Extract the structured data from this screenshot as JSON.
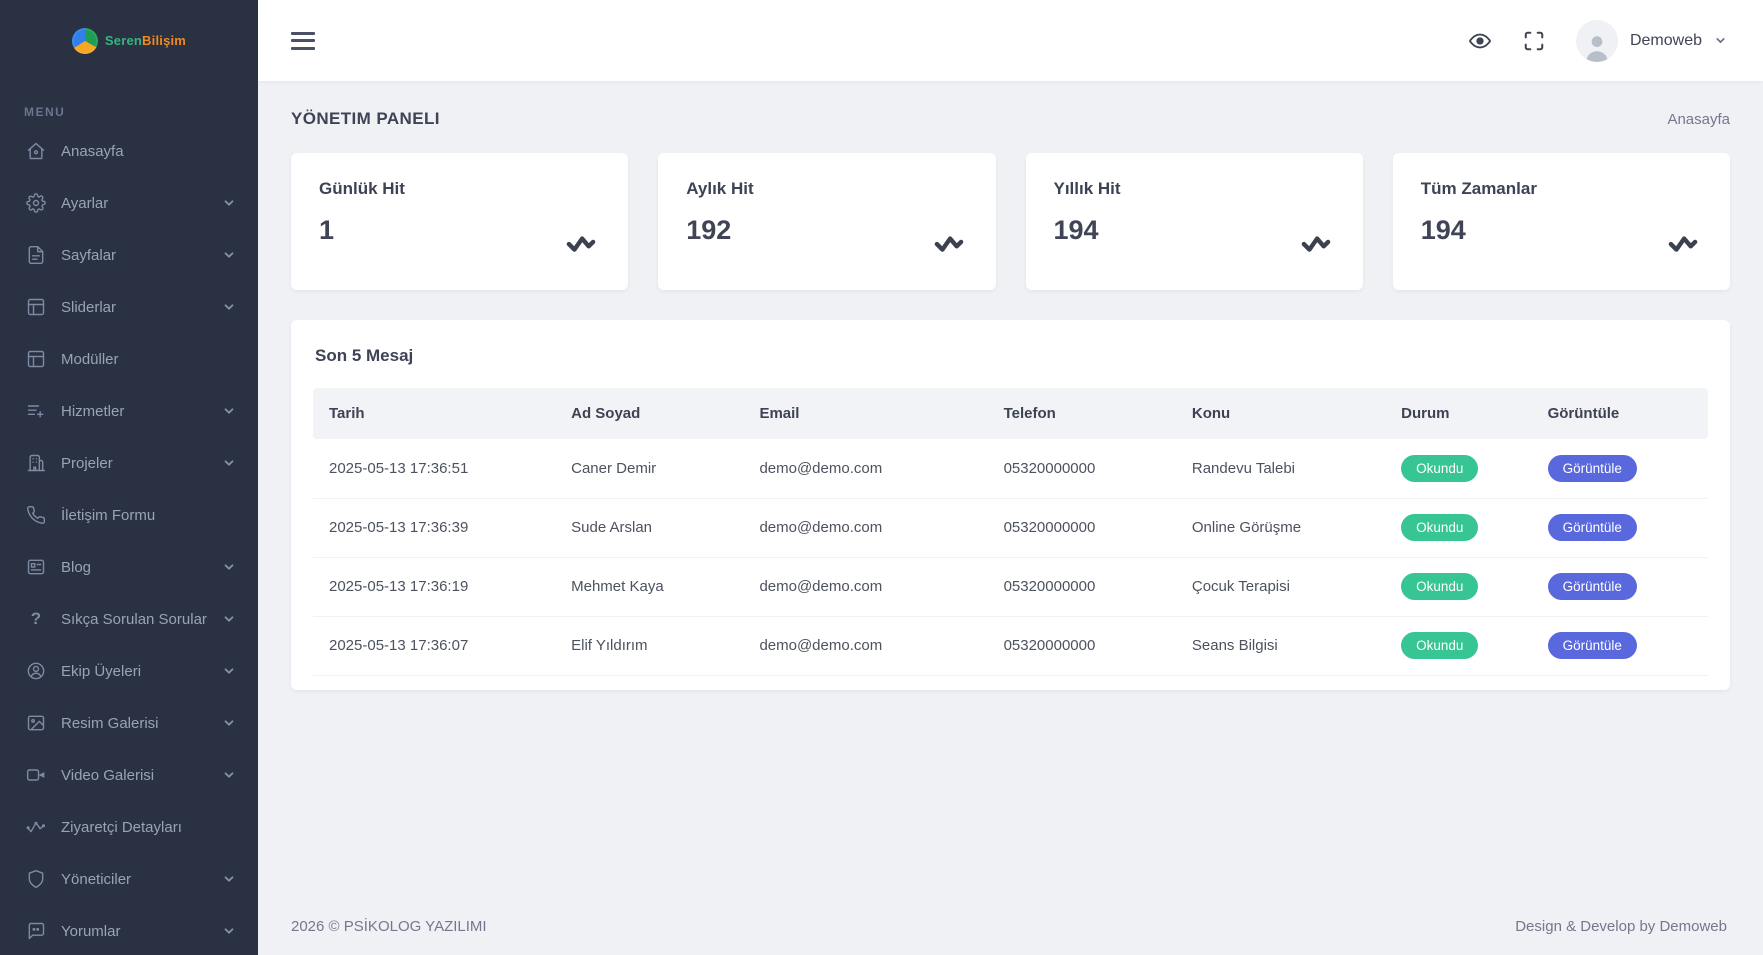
{
  "colors": {
    "sidebar_bg": "#2a3142",
    "status_green": "#37c593",
    "action_indigo": "#5a68dd",
    "brand_green": "#35b57f",
    "brand_orange": "#f08a1d"
  },
  "brand": {
    "name_part1": "Seren",
    "name_part2": "Bilişim"
  },
  "sidebar": {
    "menu_label": "MENU",
    "items": [
      {
        "label": "Anasayfa",
        "icon": "home-icon",
        "chevron": false
      },
      {
        "label": "Ayarlar",
        "icon": "gear-icon",
        "chevron": true
      },
      {
        "label": "Sayfalar",
        "icon": "file-icon",
        "chevron": true
      },
      {
        "label": "Sliderlar",
        "icon": "layout-icon",
        "chevron": true
      },
      {
        "label": "Modüller",
        "icon": "layout-icon",
        "chevron": false
      },
      {
        "label": "Hizmetler",
        "icon": "list-plus-icon",
        "chevron": true
      },
      {
        "label": "Projeler",
        "icon": "building-icon",
        "chevron": true
      },
      {
        "label": "İletişim Formu",
        "icon": "phone-icon",
        "chevron": false
      },
      {
        "label": "Blog",
        "icon": "blog-card-icon",
        "chevron": true
      },
      {
        "label": "Sıkça Sorulan Sorular",
        "icon": "question-icon",
        "chevron": true
      },
      {
        "label": "Ekip Üyeleri",
        "icon": "user-circle-icon",
        "chevron": true
      },
      {
        "label": "Resim Galerisi",
        "icon": "image-icon",
        "chevron": true
      },
      {
        "label": "Video Galerisi",
        "icon": "video-icon",
        "chevron": true
      },
      {
        "label": "Ziyaretçi Detayları",
        "icon": "activity-icon",
        "chevron": false
      },
      {
        "label": "Yöneticiler",
        "icon": "shield-icon",
        "chevron": true
      },
      {
        "label": "Yorumlar",
        "icon": "comment-icon",
        "chevron": true
      }
    ]
  },
  "topbar": {
    "icons": [
      "menu-icon",
      "eye-icon",
      "fullscreen-icon"
    ],
    "user_name": "Demoweb"
  },
  "page": {
    "title": "YÖNETIM PANELI",
    "breadcrumb": "Anasayfa"
  },
  "stats": {
    "cards": [
      {
        "label": "Günlük Hit",
        "value": "1",
        "icon": "activity-icon"
      },
      {
        "label": "Aylık Hit",
        "value": "192",
        "icon": "activity-icon"
      },
      {
        "label": "Yıllık Hit",
        "value": "194",
        "icon": "activity-icon"
      },
      {
        "label": "Tüm Zamanlar",
        "value": "194",
        "icon": "activity-icon"
      }
    ]
  },
  "messages": {
    "title": "Son 5 Mesaj",
    "columns": [
      "Tarih",
      "Ad Soyad",
      "Email",
      "Telefon",
      "Konu",
      "Durum",
      "Görüntüle"
    ],
    "rows": [
      {
        "date": "2025-05-13 17:36:51",
        "name": "Caner Demir",
        "email": "demo@demo.com",
        "phone": "05320000000",
        "subject": "Randevu Talebi",
        "status": "Okundu",
        "action": "Görüntüle"
      },
      {
        "date": "2025-05-13 17:36:39",
        "name": "Sude Arslan",
        "email": "demo@demo.com",
        "phone": "05320000000",
        "subject": "Online Görüşme",
        "status": "Okundu",
        "action": "Görüntüle"
      },
      {
        "date": "2025-05-13 17:36:19",
        "name": "Mehmet Kaya",
        "email": "demo@demo.com",
        "phone": "05320000000",
        "subject": "Çocuk Terapisi",
        "status": "Okundu",
        "action": "Görüntüle"
      },
      {
        "date": "2025-05-13 17:36:07",
        "name": "Elif Yıldırım",
        "email": "demo@demo.com",
        "phone": "05320000000",
        "subject": "Seans Bilgisi",
        "status": "Okundu",
        "action": "Görüntüle"
      }
    ]
  },
  "footer": {
    "left": "2026 © PSİKOLOG YAZILIMI",
    "right": "Design & Develop by Demoweb"
  }
}
